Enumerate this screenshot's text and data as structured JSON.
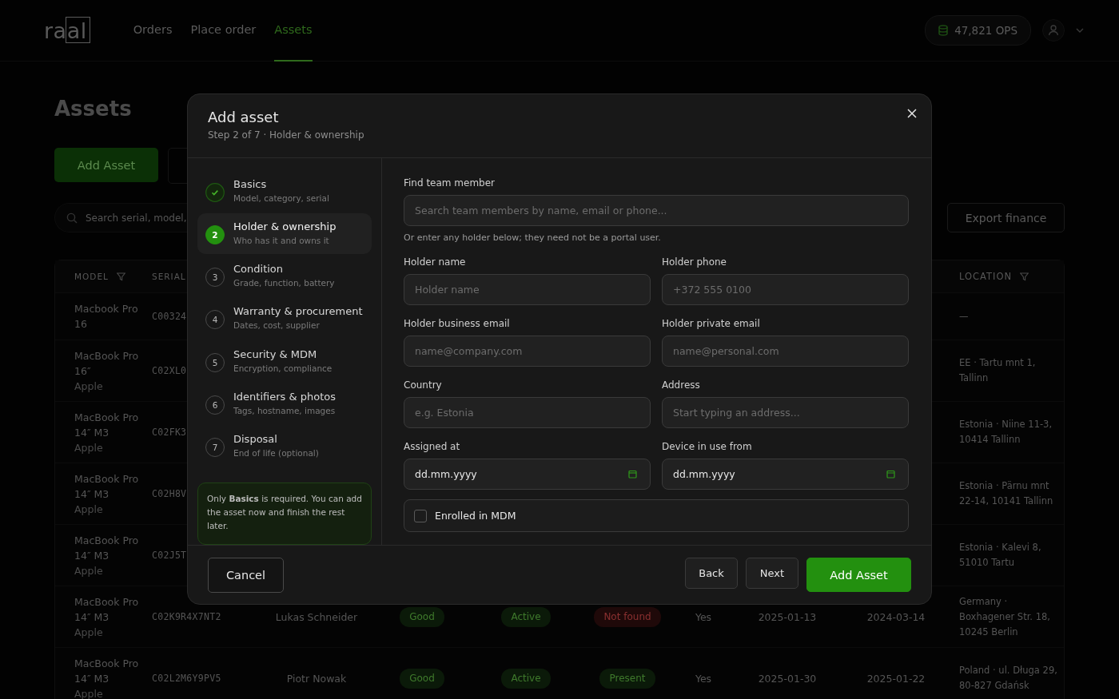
{
  "nav": {
    "logo": "raal",
    "items": [
      {
        "label": "Orders",
        "selected": false
      },
      {
        "label": "Place order",
        "selected": false
      },
      {
        "label": "Assets",
        "selected": true
      }
    ],
    "credits": "47,821 OPS"
  },
  "page": {
    "title": "Assets",
    "add_button": "Add Asset",
    "search": {
      "placeholder": "Search serial, model,"
    },
    "export_button": "Export finance"
  },
  "table": {
    "header": {
      "model": {
        "label": "MODEL",
        "filter": true
      },
      "serial": {
        "label": "SERIAL"
      },
      "location": {
        "label": "LOCATION",
        "filter": true
      }
    },
    "rows": [
      {
        "model": "Macbook Pro 16",
        "serial": "C00324",
        "location": "—"
      },
      {
        "model": "MacBook Pro 16″",
        "brand": "Apple",
        "serial": "C02XL0",
        "location": "EE · Tartu mnt 1, Tallinn"
      },
      {
        "model": "MacBook Pro 14″ M3",
        "brand": "Apple",
        "serial": "C02FK3",
        "location": "Estonia · Niine 11-3, 10414 Tallinn"
      },
      {
        "model": "MacBook Pro 14″ M3",
        "brand": "Apple",
        "serial": "C02H8V",
        "location": "Estonia · Pärnu mnt 22-14, 10141 Tallinn"
      },
      {
        "model": "MacBook Pro 14″ M3",
        "brand": "Apple",
        "serial": "C02J5T",
        "location": "Estonia · Kalevi 8, 51010 Tartu"
      },
      {
        "model": "MacBook Pro 14″ M3",
        "brand": "Apple",
        "serial": "C02K9R4X7NT2",
        "holder": "Lukas Schneider",
        "grade": {
          "label": "Good",
          "kind": "positive"
        },
        "status": {
          "label": "Active",
          "kind": "positive"
        },
        "presence": {
          "label": "Not found",
          "kind": "negative"
        },
        "mdm": "Yes",
        "date_1": "2025-01-13",
        "date_2": "2024-03-14",
        "location": "Germany · Boxhagener Str. 18, 10245 Berlin"
      },
      {
        "model": "MacBook Pro 14″ M3",
        "brand": "Apple",
        "serial": "C02L2M6Y9PV5",
        "holder": "Piotr Nowak",
        "grade": {
          "label": "Good",
          "kind": "positive"
        },
        "status": {
          "label": "Active",
          "kind": "positive"
        },
        "presence": {
          "label": "Present",
          "kind": "positive"
        },
        "mdm": "Yes",
        "date_1": "2025-01-30",
        "date_2": "2025-01-22",
        "location": "Poland · ul. Długa 29, 80-827 Gdańsk"
      }
    ]
  },
  "dialog": {
    "title": "Add asset",
    "subtitle": "Step 2 of 7 · Holder & ownership",
    "steps": [
      {
        "kind": "done",
        "selected": false,
        "title": "Basics",
        "subtitle": "Model, category, serial"
      },
      {
        "kind": "current",
        "selected": true,
        "number": "2",
        "title": "Holder & ownership",
        "subtitle": "Who has it and owns it"
      },
      {
        "kind": "pending",
        "selected": false,
        "number": "3",
        "title": "Condition",
        "subtitle": "Grade, function, battery"
      },
      {
        "kind": "pending",
        "selected": false,
        "number": "4",
        "title": "Warranty & procurement",
        "subtitle": "Dates, cost, supplier"
      },
      {
        "kind": "pending",
        "selected": false,
        "number": "5",
        "title": "Security & MDM",
        "subtitle": "Encryption, compliance"
      },
      {
        "kind": "pending",
        "selected": false,
        "number": "6",
        "title": "Identifiers & photos",
        "subtitle": "Tags, hostname, images"
      },
      {
        "kind": "pending",
        "selected": false,
        "number": "7",
        "title": "Disposal",
        "subtitle": "End of life (optional)"
      }
    ],
    "notice": "Only **Basics** is required. You can add the asset now and finish the rest later.",
    "find": {
      "label": "Find team member",
      "placeholder": "Search team members by name, email or phone...",
      "hint": "Or enter any holder below; they need not be a portal user."
    },
    "fields": [
      {
        "kind": "text",
        "label": "Holder name",
        "placeholder": "Holder name"
      },
      {
        "kind": "text",
        "label": "Holder phone",
        "placeholder": "+372 555 0100"
      },
      {
        "kind": "text",
        "label": "Holder business email",
        "placeholder": "name@company.com"
      },
      {
        "kind": "text",
        "label": "Holder private email",
        "placeholder": "name@personal.com"
      },
      {
        "kind": "text",
        "label": "Country",
        "placeholder": "e.g. Estonia"
      },
      {
        "kind": "text",
        "label": "Address",
        "placeholder": "Start typing an address..."
      },
      {
        "kind": "date",
        "label": "Assigned at",
        "value": "dd.mm.yyyy"
      },
      {
        "kind": "date",
        "label": "Device in use from",
        "value": "dd.mm.yyyy"
      }
    ],
    "mdm_checkbox": {
      "label": "Enrolled in MDM",
      "checked": false
    },
    "buttons": {
      "cancel": "Cancel",
      "back": "Back",
      "next": "Next",
      "submit": "Add Asset"
    }
  }
}
